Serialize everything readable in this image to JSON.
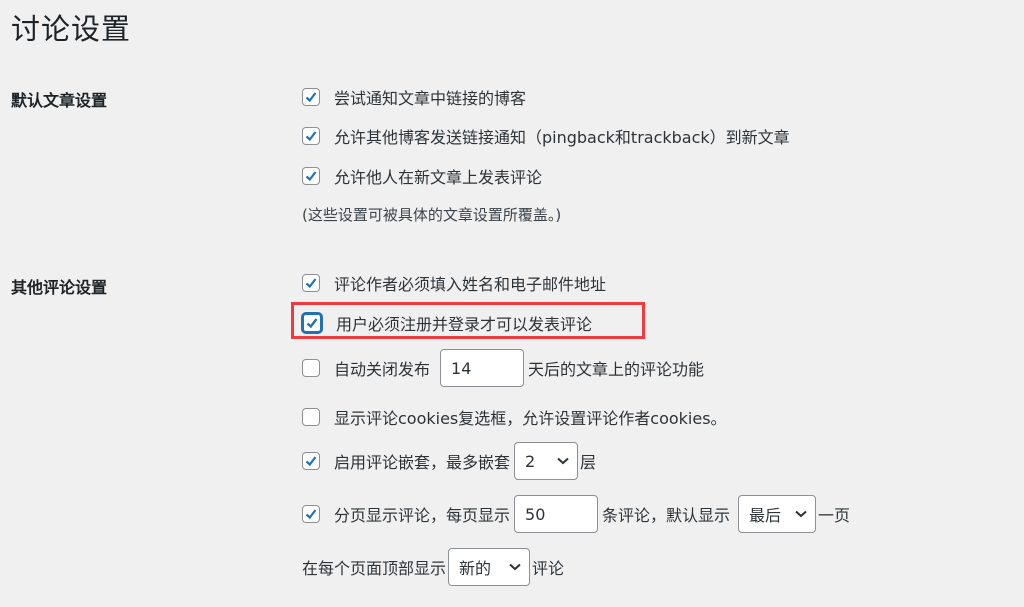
{
  "page": {
    "title": "讨论设置"
  },
  "sections": {
    "default_post": {
      "label": "默认文章设置",
      "items": [
        {
          "label": "尝试通知文章中链接的博客",
          "checked": true
        },
        {
          "label": "允许其他博客发送链接通知（pingback和trackback）到新文章",
          "checked": true
        },
        {
          "label": "允许他人在新文章上发表评论",
          "checked": true
        }
      ],
      "hint": "(这些设置可被具体的文章设置所覆盖。)"
    },
    "other_comment": {
      "label": "其他评论设置",
      "require_name_email": {
        "label": "评论作者必须填入姓名和电子邮件地址",
        "checked": true
      },
      "require_registration": {
        "label": "用户必须注册并登录才可以发表评论",
        "checked": true,
        "highlighted": true
      },
      "auto_close": {
        "label_before": "自动关闭发布",
        "value": "14",
        "label_after": "天后的文章上的评论功能",
        "checked": false
      },
      "cookies": {
        "label": "显示评论cookies复选框，允许设置评论作者cookies。",
        "checked": false
      },
      "threaded": {
        "label_before": "启用评论嵌套，最多嵌套",
        "value": "2",
        "label_after": "层",
        "checked": true
      },
      "paged": {
        "label_before": "分页显示评论，每页显示",
        "per_page": "50",
        "label_mid": "条评论，默认显示",
        "default_page": "最后",
        "label_after": "一页",
        "checked": true
      },
      "order": {
        "label_before": "在每个页面顶部显示",
        "value": "新的",
        "label_after": "评论"
      }
    }
  },
  "colors": {
    "accent": "#2271b1",
    "highlight": "#ef3b3f",
    "background": "#f0f0f1"
  }
}
